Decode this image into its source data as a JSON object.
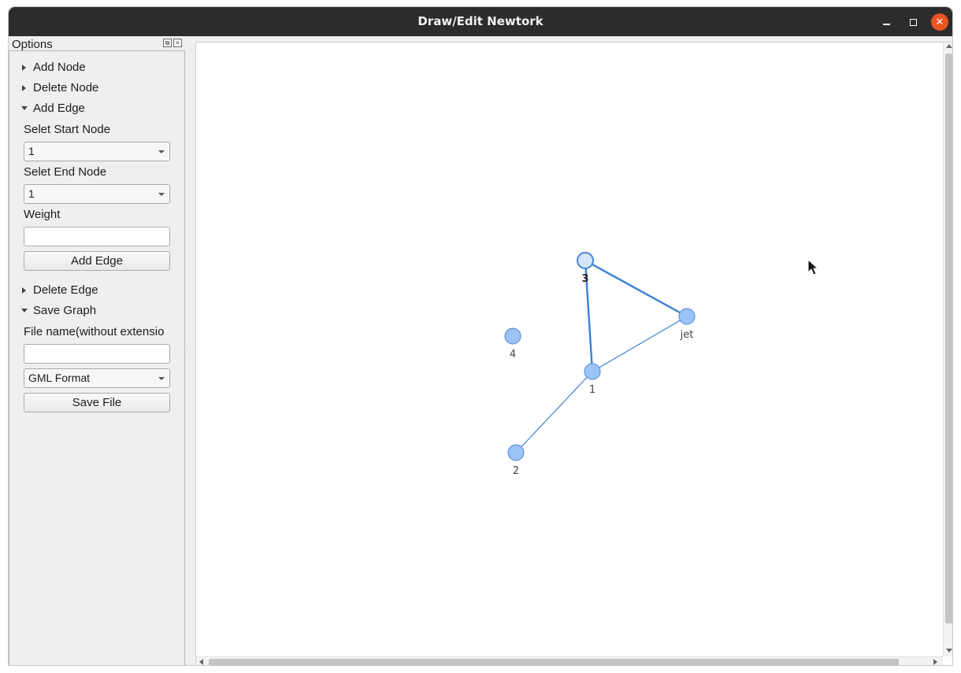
{
  "window": {
    "title": "Draw/Edit Newtork"
  },
  "dock": {
    "title": "Options",
    "sections": {
      "add_node": "Add Node",
      "delete_node": "Delete Node",
      "add_edge": "Add Edge",
      "delete_edge": "Delete Edge",
      "save_graph": "Save Graph"
    },
    "add_edge": {
      "start_label": "Selet Start Node",
      "start_value": "1",
      "end_label": "Selet End Node",
      "end_value": "1",
      "weight_label": "Weight",
      "weight_value": "",
      "button": "Add Edge"
    },
    "save_graph": {
      "file_label": "File name(without extensio",
      "file_value": "",
      "format_value": "GML Format",
      "button": "Save File"
    }
  },
  "graph": {
    "nodes": [
      {
        "id": "3",
        "label": "3",
        "selected": true
      },
      {
        "id": "jet",
        "label": "jet",
        "selected": false
      },
      {
        "id": "4",
        "label": "4",
        "selected": false
      },
      {
        "id": "1",
        "label": "1",
        "selected": false
      },
      {
        "id": "2",
        "label": "2",
        "selected": false
      }
    ],
    "edges": [
      {
        "from": "3",
        "to": "jet",
        "highlighted": true
      },
      {
        "from": "3",
        "to": "1",
        "highlighted": true
      },
      {
        "from": "1",
        "to": "jet",
        "highlighted": false
      },
      {
        "from": "1",
        "to": "2",
        "highlighted": false
      }
    ],
    "colors": {
      "node_fill": "#9cc3f5",
      "node_selected_fill": "#d5e6fa",
      "node_stroke": "#4a86d6",
      "edge": "#3a7fd4"
    }
  }
}
